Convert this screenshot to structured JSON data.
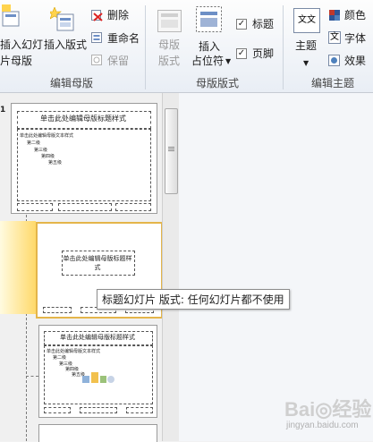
{
  "ribbon": {
    "insert_slide_master_line1": "插入幻灯",
    "insert_slide_master_line2": "片母版",
    "insert_layout": "插入版式",
    "delete": "删除",
    "rename": "重命名",
    "preserve": "保留",
    "group_edit_master": "编辑母版",
    "master_layout_line1": "母版",
    "master_layout_line2": "版式",
    "insert_placeholder_line1": "插入",
    "insert_placeholder_line2": "占位符",
    "title_check": "标题",
    "footer_check": "页脚",
    "group_master_layout": "母版版式",
    "theme": "主题",
    "colors": "颜色",
    "fonts": "字体",
    "effects": "效果",
    "group_edit_theme": "编辑主题",
    "theme_icon_text": "文文",
    "font_icon_text": "文"
  },
  "slides": {
    "master_title": "单击此处编辑母版标题样式",
    "master_text": "单击此处编辑母版文本样式",
    "level2": "第二级",
    "level3": "第三级",
    "level4": "第四级",
    "level5": "第五级",
    "layout_title": "单击此处编辑母版标题样式",
    "slide1_number": "1"
  },
  "tooltip": "标题幻灯片 版式: 任何幻灯片都不使用",
  "watermark": {
    "brand": "Bai◎经验",
    "url": "jingyan.baidu.com"
  }
}
